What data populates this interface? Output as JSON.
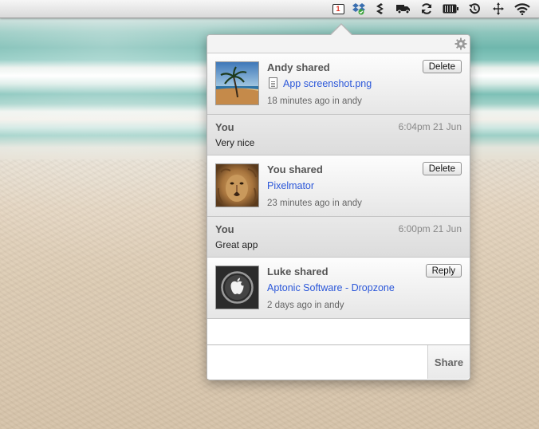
{
  "menubar": {
    "icons": [
      {
        "name": "notification-badge-icon",
        "badge": "1"
      },
      {
        "name": "dropbox-icon"
      },
      {
        "name": "droplr-icon"
      },
      {
        "name": "truck-icon"
      },
      {
        "name": "sync-icon"
      },
      {
        "name": "battery-icon"
      },
      {
        "name": "time-machine-icon"
      },
      {
        "name": "move-icon"
      },
      {
        "name": "wifi-icon"
      }
    ]
  },
  "panel": {
    "settings_icon": "gear-icon",
    "items": [
      {
        "type": "share",
        "title": "Andy shared",
        "link": "App screenshot.png",
        "meta": "18 minutes ago in andy",
        "button": "Delete",
        "thumb": "beach-palm-photo"
      },
      {
        "type": "comment",
        "author": "You",
        "time": "6:04pm 21 Jun",
        "text": "Very nice"
      },
      {
        "type": "share",
        "title": "You shared",
        "link": "Pixelmator",
        "meta": "23 minutes ago in andy",
        "button": "Delete",
        "thumb": "lion-photo"
      },
      {
        "type": "comment",
        "author": "You",
        "time": "6:00pm 21 Jun",
        "text": "Great app"
      },
      {
        "type": "share",
        "title": "Luke shared",
        "link": "Aptonic Software - Dropzone",
        "meta": "2 days ago in andy",
        "button": "Reply",
        "thumb": "apple-logo"
      }
    ],
    "footer": {
      "input_placeholder": "",
      "share_label": "Share"
    }
  },
  "colors": {
    "link": "#2b57d9",
    "badge": "#e03020"
  }
}
